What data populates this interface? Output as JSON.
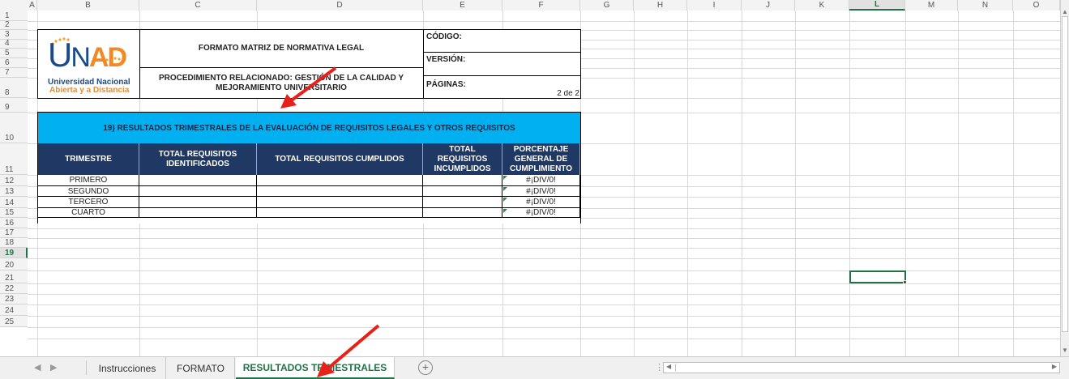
{
  "name_box": "",
  "columns": [
    "A",
    "B",
    "C",
    "D",
    "E",
    "F",
    "G",
    "H",
    "I",
    "J",
    "K",
    "L",
    "M",
    "N",
    "O"
  ],
  "selected_column": "L",
  "rows": [
    "1",
    "2",
    "3",
    "4",
    "5",
    "6",
    "7",
    "8",
    "9",
    "10",
    "11",
    "12",
    "13",
    "14",
    "15",
    "16",
    "17",
    "18",
    "19",
    "20",
    "21",
    "22",
    "23",
    "24",
    "25"
  ],
  "selected_row": "19",
  "logo": {
    "letters": "UNAD",
    "line1": "Universidad Nacional",
    "line2": "Abierta y a Distancia",
    "colors": {
      "u_and_n": "#1a4a8a",
      "ad": "#f08a24",
      "dots": "#f5a623",
      "subtitle1": "#1a4a8a",
      "subtitle2": "#f08a24"
    }
  },
  "header": {
    "format_title": "FORMATO MATRIZ DE NORMATIVA LEGAL",
    "procedure": "PROCEDIMIENTO RELACIONADO: GESTIÓN DE LA CALIDAD Y MEJORAMIENTO UNIVERSITARIO",
    "code_label": "CÓDIGO:",
    "version_label": "VERSIÓN:",
    "pages_label": "PÁGINAS:",
    "pages_value": "2 de 2"
  },
  "results_title": "19) RESULTADOS TRIMESTRALES DE LA EVALUACIÓN DE REQUISITOS LEGALES Y OTROS REQUISITOS",
  "table": {
    "headers": [
      "TRIMESTRE",
      "TOTAL REQUISITOS IDENTIFICADOS",
      "TOTAL REQUISITOS CUMPLIDOS",
      "TOTAL REQUISITOS INCUMPLIDOS",
      "PORCENTAJE GENERAL DE CUMPLIMIENTO"
    ],
    "rows": [
      [
        "PRIMERO",
        "",
        "",
        "",
        "#¡DIV/0!"
      ],
      [
        "SEGUNDO",
        "",
        "",
        "",
        "#¡DIV/0!"
      ],
      [
        "TERCERO",
        "",
        "",
        "",
        "#¡DIV/0!"
      ],
      [
        "CUARTO",
        "",
        "",
        "",
        "#¡DIV/0!"
      ]
    ]
  },
  "sheet_tabs": [
    {
      "label": "Instrucciones",
      "active": false
    },
    {
      "label": "FORMATO",
      "active": false
    },
    {
      "label": "RESULTADOS TRIMESTRALES",
      "active": true
    }
  ],
  "colors": {
    "band": "#00b0f0",
    "table_header": "#1f3864",
    "excel_green": "#217346",
    "annotation_arrow": "#e8201a"
  }
}
